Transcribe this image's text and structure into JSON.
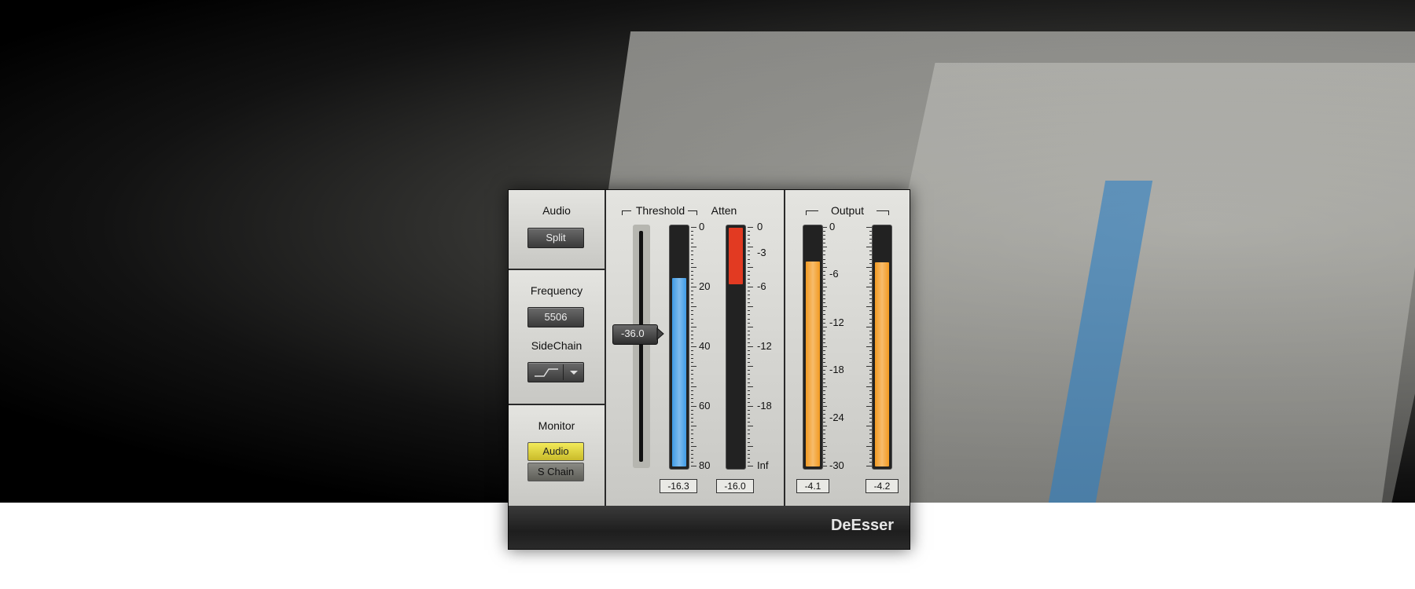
{
  "colors": {
    "threshold_meter": "#3f9be6",
    "atten_meter": "#e23a22",
    "output_meter": "#f29a22",
    "monitor_audio_active": "#e3d83a"
  },
  "audio": {
    "label": "Audio",
    "button": "Split"
  },
  "frequency": {
    "label": "Frequency",
    "value": "5506"
  },
  "sidechain": {
    "label": "SideChain",
    "filter_icon": "high-pass-filter-icon"
  },
  "monitor": {
    "label": "Monitor",
    "audio_button": "Audio",
    "schain_button": "S Chain"
  },
  "threshold": {
    "label": "Threshold",
    "slider_value": "-36.0",
    "meter_level_db": 16.3,
    "readout": "-16.3",
    "scale": [
      "0",
      "20",
      "40",
      "60",
      "80"
    ]
  },
  "atten": {
    "label": "Atten",
    "meter_level_db": 5.5,
    "readout": "-16.0",
    "scale": [
      "0",
      "-3",
      "-6",
      "-12",
      "-18",
      "Inf"
    ]
  },
  "output": {
    "label": "Output",
    "left_level_db": -4.1,
    "right_level_db": -4.2,
    "readout_left": "-4.1",
    "readout_right": "-4.2",
    "scale": [
      "0",
      "-6",
      "-12",
      "-18",
      "-24",
      "-30"
    ]
  },
  "plugin_name": "DeEsser"
}
